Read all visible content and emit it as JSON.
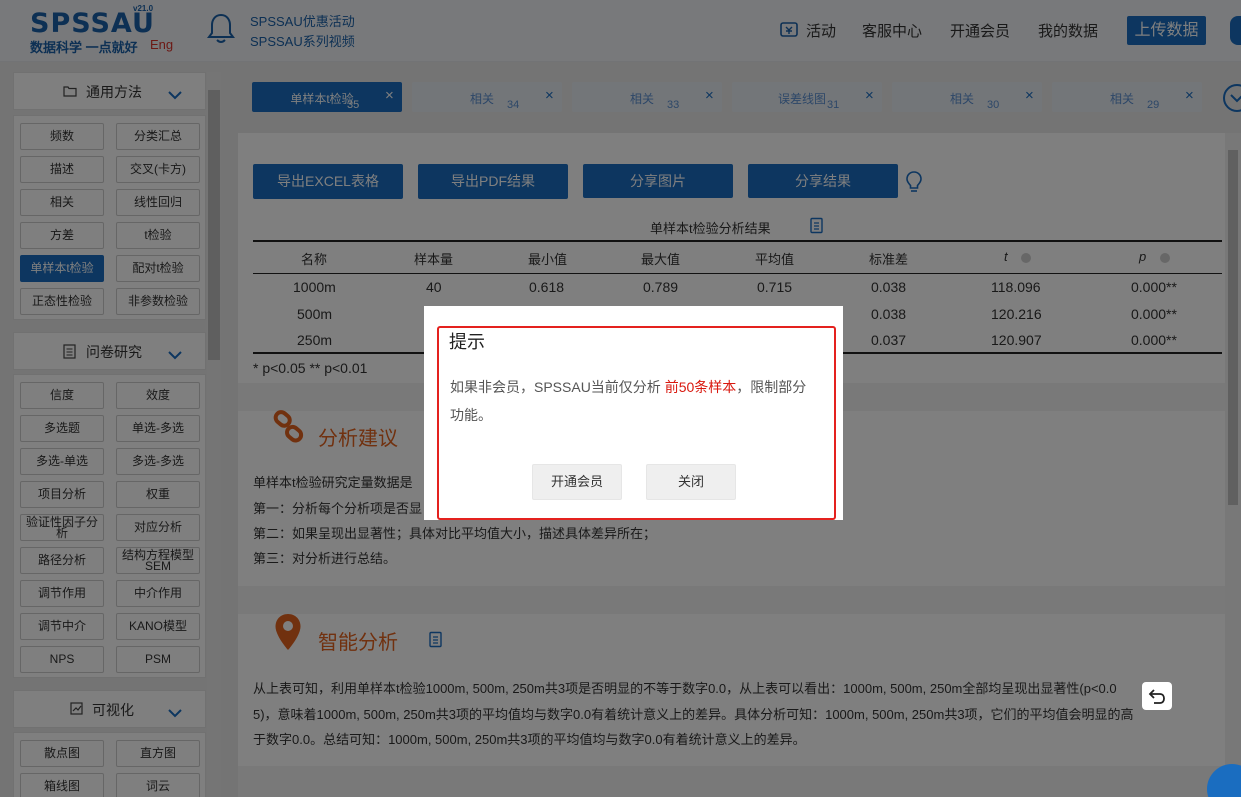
{
  "header": {
    "logo": "SPSSAU",
    "logo_version": "v21.0",
    "slogan": "数据科学 一点就好",
    "lang_link": "Eng",
    "promos": [
      "SPSSAU优惠活动",
      "SPSSAU系列视频"
    ],
    "nav": {
      "activity": "活动",
      "service": "客服中心",
      "vip": "开通会员",
      "mydata": "我的数据",
      "upload": "上传数据"
    }
  },
  "sidebar": {
    "sections": [
      {
        "title": "通用方法",
        "icon": "folder-icon",
        "items": [
          "频数",
          "分类汇总",
          "描述",
          "交叉(卡方)",
          "相关",
          "线性回归",
          "方差",
          "t检验",
          "单样本t检验",
          "配对t检验",
          "正态性检验",
          "非参数检验"
        ],
        "active": "单样本t检验"
      },
      {
        "title": "问卷研究",
        "icon": "document-icon",
        "items": [
          "信度",
          "效度",
          "多选题",
          "单选-多选",
          "多选-单选",
          "多选-多选",
          "项目分析",
          "权重",
          "验证性因子分析",
          "对应分析",
          "路径分析",
          "结构方程模型SEM",
          "调节作用",
          "中介作用",
          "调节中介",
          "KANO模型",
          "NPS",
          "PSM"
        ]
      },
      {
        "title": "可视化",
        "icon": "chart-icon",
        "items": [
          "散点图",
          "直方图",
          "箱线图",
          "词云"
        ]
      }
    ]
  },
  "tabs": [
    {
      "label": "单样本t检验",
      "num": "35",
      "active": true
    },
    {
      "label": "相关",
      "num": "34"
    },
    {
      "label": "相关",
      "num": "33"
    },
    {
      "label": "误差线图",
      "num": "31"
    },
    {
      "label": "相关",
      "num": "30"
    },
    {
      "label": "相关",
      "num": "29"
    }
  ],
  "actions": {
    "export_excel": "导出EXCEL表格",
    "export_pdf": "导出PDF结果",
    "share_image": "分享图片",
    "share_result": "分享结果"
  },
  "table": {
    "title": "单样本t检验分析结果",
    "columns": [
      "名称",
      "样本量",
      "最小值",
      "最大值",
      "平均值",
      "标准差",
      "t",
      "p"
    ],
    "rows": [
      [
        "1000m",
        "40",
        "0.618",
        "0.789",
        "0.715",
        "0.038",
        "118.096",
        "0.000**"
      ],
      [
        "500m",
        "",
        "",
        "",
        "",
        "0.038",
        "120.216",
        "0.000**"
      ],
      [
        "250m",
        "",
        "",
        "",
        "",
        "0.037",
        "120.907",
        "0.000**"
      ]
    ],
    "note": "* p<0.05 ** p<0.01"
  },
  "advice": {
    "title": "分析建议",
    "lines": [
      "单样本t检验研究定量数据是",
      "第一：分析每个分析项是否显",
      "第二：如果呈现出显著性；具体对比平均值大小，描述具体差异所在；",
      "第三：对分析进行总结。"
    ]
  },
  "smart": {
    "title": "智能分析",
    "lines": [
      "从上表可知，利用单样本t检验1000m, 500m, 250m共3项是否明显的不等于数字0.0，从上表可以看出：1000m, 500m, 250m全部均呈现出显著性(p<0.0",
      "5)，意味着1000m, 500m, 250m共3项的平均值均与数字0.0有着统计意义上的差异。具体分析可知：1000m, 500m, 250m共3项，它们的平均值会明显的高",
      "于数字0.0。总结可知：1000m, 500m, 250m共3项的平均值均与数字0.0有着统计意义上的差异。"
    ]
  },
  "modal": {
    "title": "提示",
    "text_before": "如果非会员，SPSSAU当前仅分析 ",
    "highlight": "前50条样本",
    "text_after": "，限制部分功能。",
    "btn_vip": "开通会员",
    "btn_close": "关闭"
  },
  "colors": {
    "brand": "#1a6dc0",
    "accent": "#e2621e",
    "highlight": "#d9190f",
    "modal_border": "#e4211e"
  }
}
